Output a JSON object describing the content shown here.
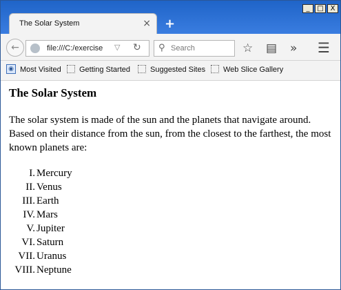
{
  "browser": {
    "tab_title": "The Solar System",
    "tab_close": "×",
    "new_tab": "+",
    "window_controls": {
      "minimize": "_",
      "maximize": "□",
      "close": "X"
    },
    "url": "file:///C:/exercise",
    "search_placeholder": "Search",
    "bookmarks": [
      "Most Visited",
      "Getting Started",
      "Suggested Sites",
      "Web Slice Gallery"
    ],
    "icons": {
      "back": "back-arrow-icon",
      "globe": "globe-icon",
      "dropdown": "chevron-down-icon",
      "reload": "reload-icon",
      "search": "search-icon",
      "star": "star-icon",
      "reader": "reading-list-icon",
      "overflow": "chevron-double-right-icon",
      "menu": "hamburger-menu-icon"
    }
  },
  "page": {
    "heading": "The Solar System",
    "paragraph": "The solar system is made of the sun and the planets that navigate around. Based on their distance from the sun, from the closest to the farthest, the most known planets are:",
    "planets": [
      {
        "num": "I.",
        "name": "Mercury"
      },
      {
        "num": "II.",
        "name": "Venus"
      },
      {
        "num": "III.",
        "name": "Earth"
      },
      {
        "num": "IV.",
        "name": "Mars"
      },
      {
        "num": "V.",
        "name": "Jupiter"
      },
      {
        "num": "VI.",
        "name": "Saturn"
      },
      {
        "num": "VII.",
        "name": "Uranus"
      },
      {
        "num": "VIII.",
        "name": "Neptune"
      }
    ]
  }
}
